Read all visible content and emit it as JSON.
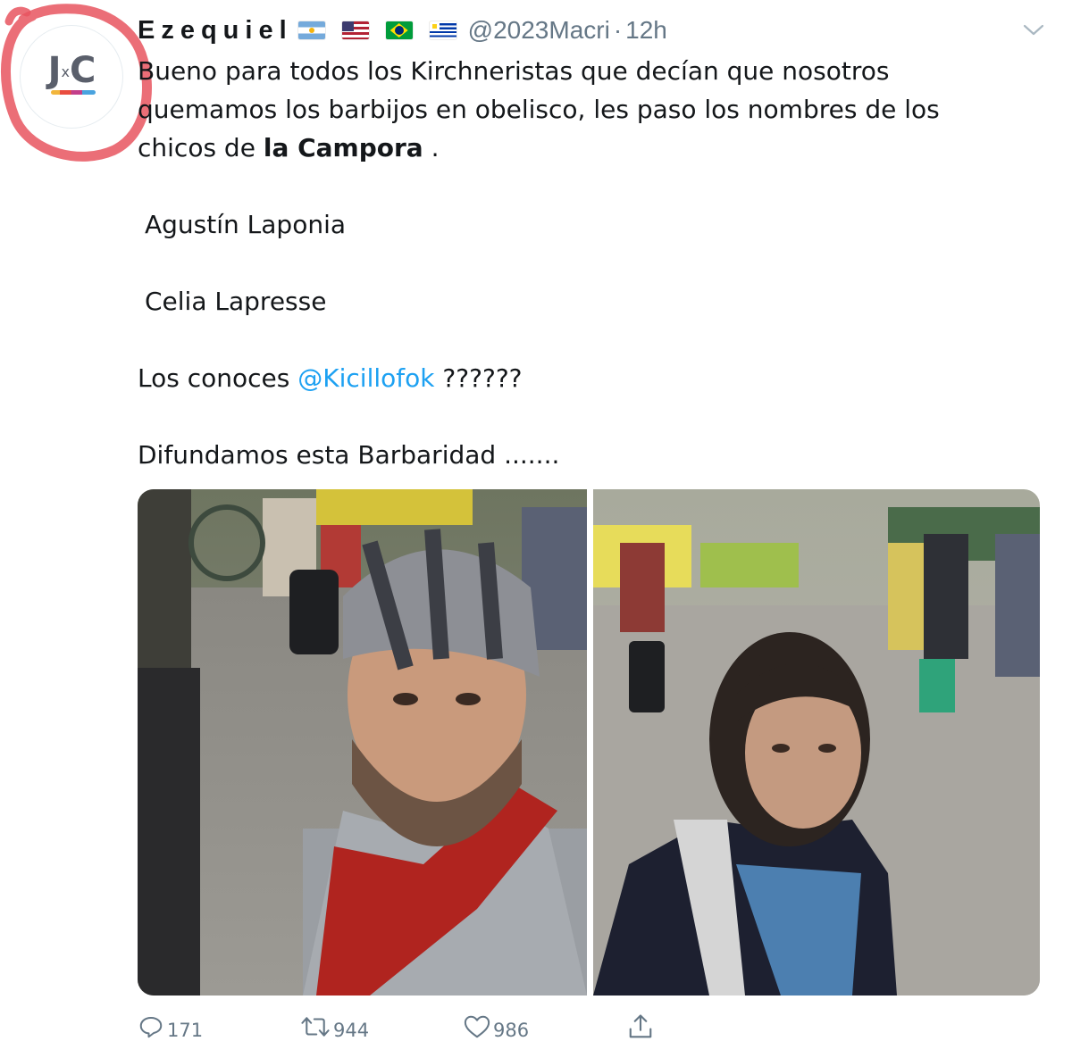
{
  "tweet": {
    "author": {
      "display_name": "Ezequiel",
      "handle": "@2023Macri",
      "time": "12h",
      "separator": "·",
      "avatar_logo": {
        "left": "J",
        "middle": "x",
        "right": "C"
      },
      "flags": [
        "argentina-flag-icon",
        "usa-flag-icon",
        "brazil-flag-icon",
        "uruguay-flag-icon"
      ]
    },
    "text": {
      "line1": "Bueno para todos los Kirchneristas que decían que nosotros",
      "line2": "quemamos los barbijos en obelisco,  les paso los nombres de los",
      "line3_start": "chicos de ",
      "line3_bold": "la Campora",
      "line3_end": " .",
      "name1": "Agustín Laponia",
      "name2": "Celia Lapresse",
      "question_start": "Los conoces ",
      "mention": "@Kicillofok",
      "question_end": " ??????",
      "closing": "Difundamos esta Barbaridad ......."
    },
    "stats": {
      "replies": "171",
      "retweets": "944",
      "likes": "986"
    }
  },
  "colors": {
    "text": "#14171a",
    "secondary": "#657786",
    "link": "#1da1f2",
    "annotation_circle": "#e8555f"
  },
  "icons": {
    "menu": "chevron-down-icon",
    "reply": "reply-icon",
    "retweet": "retweet-icon",
    "like": "heart-icon",
    "share": "share-icon"
  }
}
